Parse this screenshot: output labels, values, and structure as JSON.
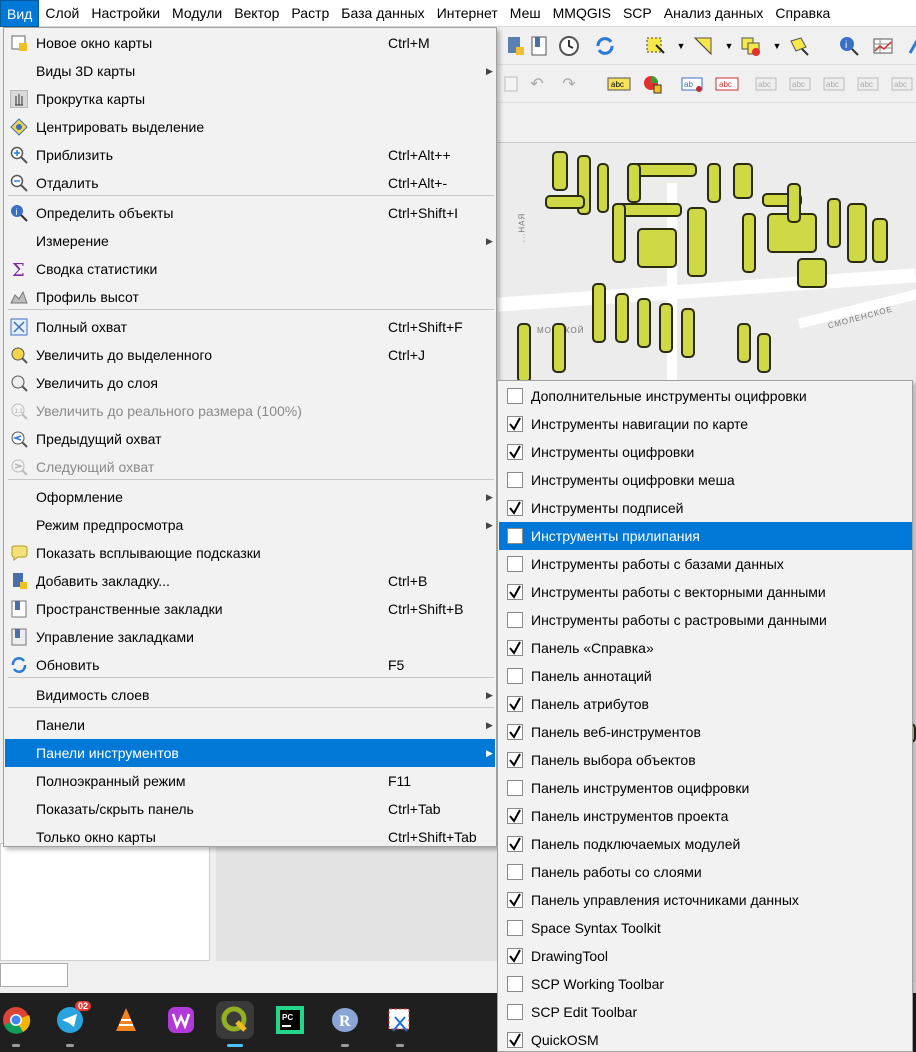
{
  "menubar": {
    "items": [
      "Вид",
      "Слой",
      "Настройки",
      "Модули",
      "Вектор",
      "Растр",
      "База данных",
      "Интернет",
      "Меш",
      "MMQGIS",
      "SCP",
      "Анализ данных",
      "Справка"
    ]
  },
  "view_menu": {
    "items": [
      {
        "label": "Новое окно карты",
        "shortcut": "Ctrl+M",
        "icon": "new-map-window-icon"
      },
      {
        "label": "Виды 3D карты",
        "submenu": true
      },
      {
        "label": "Прокрутка карты",
        "icon": "pan-hand-icon"
      },
      {
        "label": "Центрировать выделение",
        "icon": "pan-to-selection-icon"
      },
      {
        "label": "Приблизить",
        "shortcut": "Ctrl+Alt++",
        "icon": "zoom-in-icon"
      },
      {
        "label": "Отдалить",
        "shortcut": "Ctrl+Alt+-",
        "icon": "zoom-out-icon"
      },
      {
        "label": "Определить объекты",
        "shortcut": "Ctrl+Shift+I",
        "icon": "identify-icon"
      },
      {
        "label": "Измерение",
        "submenu": true
      },
      {
        "label": "Сводка статистики",
        "icon": "sigma-icon"
      },
      {
        "label": "Профиль высот",
        "icon": "elevation-profile-icon"
      },
      {
        "label": "Полный охват",
        "shortcut": "Ctrl+Shift+F",
        "icon": "zoom-full-icon"
      },
      {
        "label": "Увеличить до выделенного",
        "shortcut": "Ctrl+J",
        "icon": "zoom-to-selected-icon"
      },
      {
        "label": "Увеличить до слоя",
        "icon": "zoom-to-layer-icon"
      },
      {
        "label": "Увеличить до реального размера (100%)",
        "icon": "zoom-actual-size-icon",
        "disabled": true
      },
      {
        "label": "Предыдущий охват",
        "icon": "zoom-last-icon"
      },
      {
        "label": "Следующий охват",
        "icon": "zoom-next-icon",
        "disabled": true
      },
      {
        "label": "Оформление",
        "submenu": true
      },
      {
        "label": "Режим предпросмотра",
        "submenu": true
      },
      {
        "label": "Показать всплывающие подсказки",
        "icon": "map-tips-icon"
      },
      {
        "label": "Добавить закладку...",
        "shortcut": "Ctrl+B",
        "icon": "new-bookmark-icon"
      },
      {
        "label": "Пространственные закладки",
        "shortcut": "Ctrl+Shift+B",
        "icon": "show-bookmarks-icon"
      },
      {
        "label": "Управление закладками",
        "icon": "bookmarks-manager-icon"
      },
      {
        "label": "Обновить",
        "shortcut": "F5",
        "icon": "refresh-icon"
      },
      {
        "label": "Видимость слоев",
        "submenu": true
      },
      {
        "label": "Панели",
        "submenu": true
      },
      {
        "label": "Панели инструментов",
        "submenu": true,
        "highlighted": true
      },
      {
        "label": "Полноэкранный режим",
        "shortcut": "F11"
      },
      {
        "label": "Показать/скрыть панель",
        "shortcut": "Ctrl+Tab"
      },
      {
        "label": "Только окно карты",
        "shortcut": "Ctrl+Shift+Tab"
      }
    ]
  },
  "toolbars_submenu": {
    "items": [
      {
        "label": "Дополнительные инструменты оцифровки",
        "checked": false
      },
      {
        "label": "Инструменты навигации по карте",
        "checked": true
      },
      {
        "label": "Инструменты оцифровки",
        "checked": true
      },
      {
        "label": "Инструменты оцифровки меша",
        "checked": false
      },
      {
        "label": "Инструменты подписей",
        "checked": true
      },
      {
        "label": "Инструменты прилипания",
        "checked": false,
        "highlighted": true
      },
      {
        "label": "Инструменты работы с базами данных",
        "checked": false
      },
      {
        "label": "Инструменты работы с векторными данными",
        "checked": true
      },
      {
        "label": "Инструменты работы с растровыми данными",
        "checked": false
      },
      {
        "label": "Панель «Справка»",
        "checked": true
      },
      {
        "label": "Панель аннотаций",
        "checked": false
      },
      {
        "label": "Панель атрибутов",
        "checked": true
      },
      {
        "label": "Панель веб-инструментов",
        "checked": true
      },
      {
        "label": "Панель выбора объектов",
        "checked": true
      },
      {
        "label": "Панель инструментов оцифровки",
        "checked": false
      },
      {
        "label": "Панель инструментов проекта",
        "checked": true
      },
      {
        "label": "Панель подключаемых модулей",
        "checked": true
      },
      {
        "label": "Панель работы со слоями",
        "checked": false
      },
      {
        "label": "Панель управления источниками данных",
        "checked": true
      },
      {
        "label": "Space Syntax Toolkit",
        "checked": false
      },
      {
        "label": "DrawingTool",
        "checked": true
      },
      {
        "label": "SCP Working Toolbar",
        "checked": false
      },
      {
        "label": "SCP Edit Toolbar",
        "checked": false
      },
      {
        "label": "QuickOSM",
        "checked": true
      }
    ]
  },
  "map": {
    "labels": [
      "МОРСКОЙ",
      "СМОЛЕНСКОЕ",
      "...НАЯ"
    ]
  },
  "taskbar": {
    "telegram_badge": "02",
    "apps": [
      "chrome-icon",
      "telegram-icon",
      "vlc-icon",
      "wps-icon",
      "qgis-icon",
      "pycharm-icon",
      "r-icon",
      "snipping-tool-icon"
    ]
  },
  "colors": {
    "highlight": "#0078d7",
    "menu_bg": "#f2f2f2",
    "building_fill": "#cfd845"
  }
}
